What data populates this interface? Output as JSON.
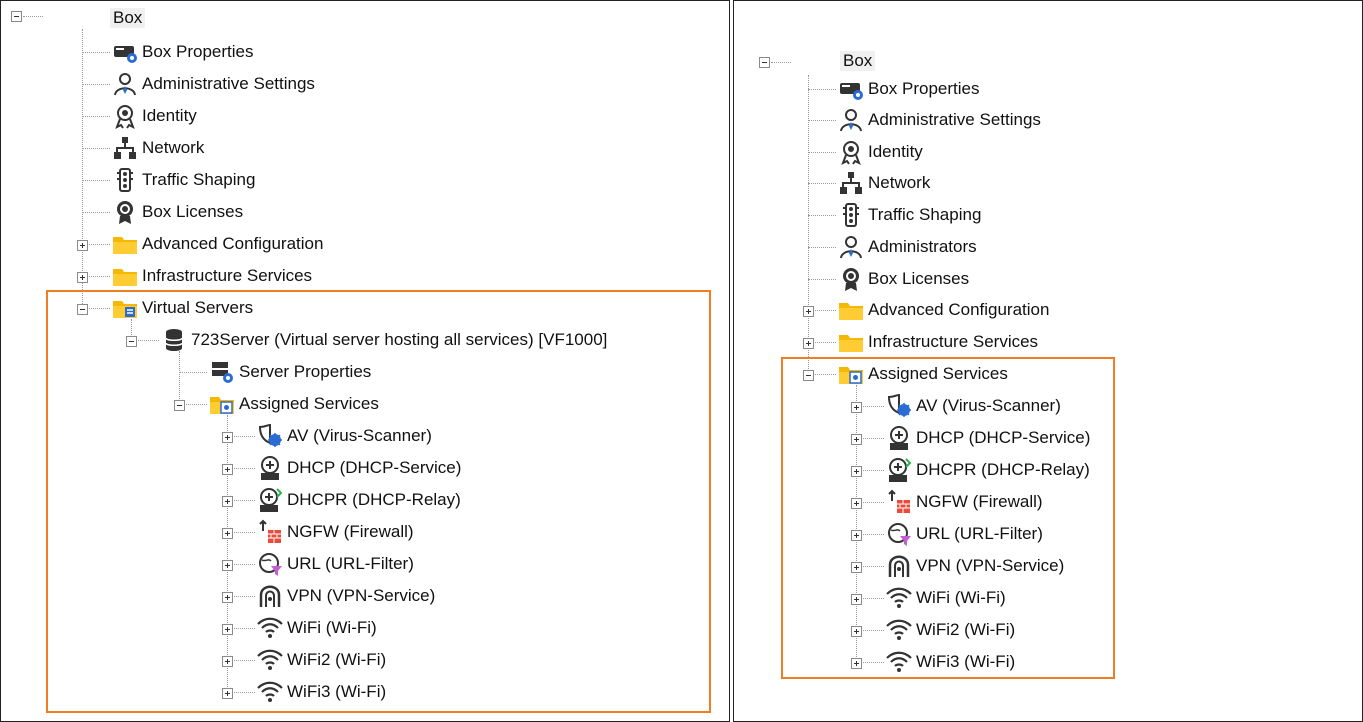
{
  "left_tree": {
    "root": "Box",
    "items": [
      {
        "label": "Box Properties",
        "icon": "box-properties-icon"
      },
      {
        "label": "Administrative Settings",
        "icon": "admin-user-icon"
      },
      {
        "label": "Identity",
        "icon": "identity-icon"
      },
      {
        "label": "Network",
        "icon": "network-icon"
      },
      {
        "label": "Traffic Shaping",
        "icon": "traffic-light-icon"
      },
      {
        "label": "Box Licenses",
        "icon": "license-badge-icon"
      },
      {
        "label": "Advanced Configuration",
        "icon": "folder-icon"
      },
      {
        "label": "Infrastructure Services",
        "icon": "folder-icon"
      },
      {
        "label": "Virtual Servers",
        "icon": "folder-db-icon"
      },
      {
        "label": "723Server (Virtual server hosting all services) [VF1000]",
        "icon": "database-icon"
      },
      {
        "label": "Server Properties",
        "icon": "server-properties-icon"
      },
      {
        "label": "Assigned Services",
        "icon": "folder-services-icon"
      },
      {
        "label": "AV (Virus-Scanner)",
        "icon": "virus-scanner-icon"
      },
      {
        "label": "DHCP (DHCP-Service)",
        "icon": "dhcp-icon"
      },
      {
        "label": "DHCPR (DHCP-Relay)",
        "icon": "dhcp-relay-icon"
      },
      {
        "label": "NGFW (Firewall)",
        "icon": "firewall-icon"
      },
      {
        "label": "URL (URL-Filter)",
        "icon": "url-filter-icon"
      },
      {
        "label": "VPN (VPN-Service)",
        "icon": "vpn-icon"
      },
      {
        "label": "WiFi (Wi-Fi)",
        "icon": "wifi-icon"
      },
      {
        "label": "WiFi2 (Wi-Fi)",
        "icon": "wifi-icon"
      },
      {
        "label": "WiFi3 (Wi-Fi)",
        "icon": "wifi-icon"
      }
    ]
  },
  "right_tree": {
    "root": "Box",
    "items": [
      {
        "label": "Box Properties",
        "icon": "box-properties-icon"
      },
      {
        "label": "Administrative Settings",
        "icon": "admin-user-icon"
      },
      {
        "label": "Identity",
        "icon": "identity-icon"
      },
      {
        "label": "Network",
        "icon": "network-icon"
      },
      {
        "label": "Traffic Shaping",
        "icon": "traffic-light-icon"
      },
      {
        "label": "Administrators",
        "icon": "admin-user-icon"
      },
      {
        "label": "Box Licenses",
        "icon": "license-badge-icon"
      },
      {
        "label": "Advanced Configuration",
        "icon": "folder-icon"
      },
      {
        "label": "Infrastructure Services",
        "icon": "folder-icon"
      },
      {
        "label": "Assigned Services",
        "icon": "folder-services-icon"
      },
      {
        "label": "AV (Virus-Scanner)",
        "icon": "virus-scanner-icon"
      },
      {
        "label": "DHCP (DHCP-Service)",
        "icon": "dhcp-icon"
      },
      {
        "label": "DHCPR (DHCP-Relay)",
        "icon": "dhcp-relay-icon"
      },
      {
        "label": "NGFW (Firewall)",
        "icon": "firewall-icon"
      },
      {
        "label": "URL (URL-Filter)",
        "icon": "url-filter-icon"
      },
      {
        "label": "VPN (VPN-Service)",
        "icon": "vpn-icon"
      },
      {
        "label": "WiFi (Wi-Fi)",
        "icon": "wifi-icon"
      },
      {
        "label": "WiFi2 (Wi-Fi)",
        "icon": "wifi-icon"
      },
      {
        "label": "WiFi3 (Wi-Fi)",
        "icon": "wifi-icon"
      }
    ]
  },
  "colors": {
    "highlight": "#f07d1f",
    "folder": "#f5b800",
    "icon_dark": "#333333",
    "icon_blue": "#2b6cd4"
  }
}
